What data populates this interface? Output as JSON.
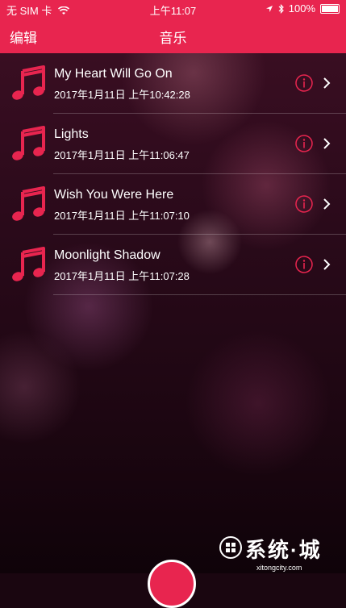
{
  "status_bar": {
    "carrier": "无 SIM 卡",
    "time": "上午11:07",
    "battery": "100%"
  },
  "nav": {
    "edit_label": "编辑",
    "title": "音乐"
  },
  "songs": [
    {
      "title": "My Heart Will Go On",
      "date": "2017年1月11日 上午10:42:28"
    },
    {
      "title": "Lights",
      "date": "2017年1月11日 上午11:06:47"
    },
    {
      "title": "Wish You Were Here",
      "date": "2017年1月11日 上午11:07:10"
    },
    {
      "title": "Moonlight Shadow",
      "date": "2017年1月11日 上午11:07:28"
    }
  ],
  "watermark": {
    "main": "系统·城",
    "sub": "xitongcity.com"
  },
  "colors": {
    "accent": "#e8254f"
  },
  "icons": [
    "music-note-icon",
    "info-icon",
    "chevron-right-icon",
    "wifi-icon",
    "location-icon",
    "bluetooth-icon",
    "battery-icon"
  ]
}
